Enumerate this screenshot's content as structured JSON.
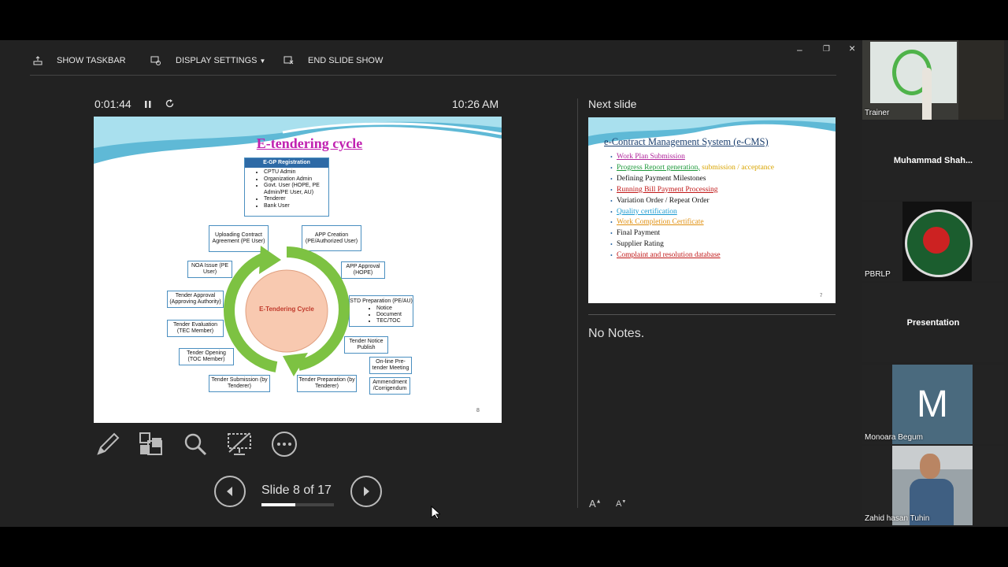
{
  "toolbar": {
    "show_taskbar": "SHOW TASKBAR",
    "display_settings": "DISPLAY SETTINGS",
    "end_slide_show": "END SLIDE SHOW"
  },
  "window": {
    "minimize": "–",
    "restore": "❐",
    "close": "×"
  },
  "presenter": {
    "timer": "0:01:44",
    "clock": "10:26 AM"
  },
  "slide": {
    "title": "E-tendering cycle",
    "page_number": "8",
    "center_label": "E-Tendering Cycle",
    "egp_header": "E-GP Registration",
    "egp_items": [
      "CPTU Admin",
      "Organization Admin",
      "Govt. User (HOPE, PE Admin/PE User, AU)",
      "Tenderer",
      "Bank User"
    ],
    "steps": {
      "uploading": "Uploading Contract Agreement (PE User)",
      "app_creation": "APP Creation (PE/Authorized User)",
      "app_approval": "APP Approval (HOPE)",
      "std_prep": "STD Preparation (PE/AU)",
      "std_items": [
        "Notice",
        "Document",
        "TEC/TOC"
      ],
      "tender_notice": "Tender Notice Publish",
      "online_pre": "On-line Pre-tender Meeting",
      "ammendment": "Ammendment /Corrigendum",
      "tender_prep": "Tender Preparation (by Tenderer)",
      "tender_sub": "Tender Submission (by Tenderer)",
      "tender_open": "Tender Opening (TOC Member)",
      "tender_eval": "Tender Evaluation (TEC Member)",
      "tender_approval": "Tender Approval (Approving Authority)",
      "noa": "NOA Issue (PE User)"
    }
  },
  "nav": {
    "slide_counter": "Slide 8 of 17",
    "progress": 0.47
  },
  "next_slide": {
    "label": "Next slide",
    "title": "e-Contract Management System (e-CMS)",
    "page_number": "7",
    "items": [
      {
        "text": "Work Plan Submission",
        "color": "#b0259b",
        "underline": true
      },
      {
        "text": "Progress Report generation,",
        "extra": " submission / acceptance",
        "color": "#1f9a3c",
        "extra_color": "#d9a400",
        "underline": true
      },
      {
        "text": "Defining Payment Milestones",
        "color": "#111",
        "underline": false
      },
      {
        "text": "Running Bill  Payment Processing",
        "color": "#c01818",
        "underline": true
      },
      {
        "text": "Variation Order / Repeat Order",
        "color": "#111",
        "underline": false
      },
      {
        "text": "Quality certification",
        "color": "#1a9ad0",
        "underline": true
      },
      {
        "text": "Work Completion Certificate",
        "color": "#e09010",
        "underline": true
      },
      {
        "text": "Final Payment",
        "color": "#111",
        "underline": false
      },
      {
        "text": "Supplier Rating",
        "color": "#111",
        "underline": false
      },
      {
        "text": "Complaint  and resolution database",
        "color": "#c01818",
        "underline": true
      }
    ]
  },
  "notes": {
    "text": "No Notes.",
    "increase": "A",
    "decrease": "A"
  },
  "participants": [
    {
      "name": "Trainer"
    },
    {
      "name": "Muhammad  Shah..."
    },
    {
      "name": "PBRLP"
    },
    {
      "name": "Presentation"
    },
    {
      "name": "Monoara Begum",
      "initial": "M"
    },
    {
      "name": "Zahid hasan Tuhin"
    }
  ],
  "colors": {
    "accent_green": "#7dc242",
    "circle_fill": "#f8c9b0",
    "circle_text": "#c0392b",
    "title_magenta": "#c020b0",
    "box_border": "#4a8fc0",
    "avatar_bg": "#4a6a7e"
  }
}
